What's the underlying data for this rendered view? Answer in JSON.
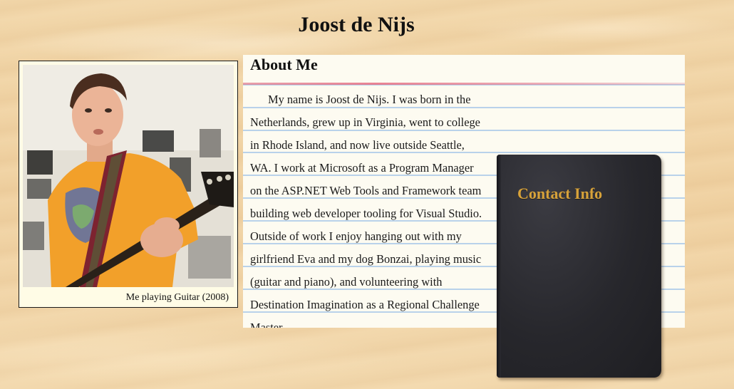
{
  "page": {
    "title": "Joost de Nijs"
  },
  "photo": {
    "caption": "Me playing Guitar (2008)"
  },
  "about": {
    "heading": "About Me",
    "text": "My name is Joost de Nijs. I was born in the Netherlands, grew up in Virginia, went to college in Rhode Island, and now live outside Seattle, WA. I work at Microsoft as a Program Manager on the ASP.NET Web Tools and Framework team building web developer tooling for Visual Studio. Outside of work I enjoy hanging out with my girlfriend Eva and my dog Bonzai, playing music (guitar and piano), and volunteering with Destination Imagination as a Regional Challenge Master."
  },
  "contact": {
    "heading": "Contact Info"
  },
  "colors": {
    "background": "#f0d3a4",
    "paper": "#fdfbf1",
    "rule_line": "#b9d2ea",
    "margin_line": "#e0788c",
    "book": "#27272c",
    "contact_heading": "#d7a23a"
  }
}
